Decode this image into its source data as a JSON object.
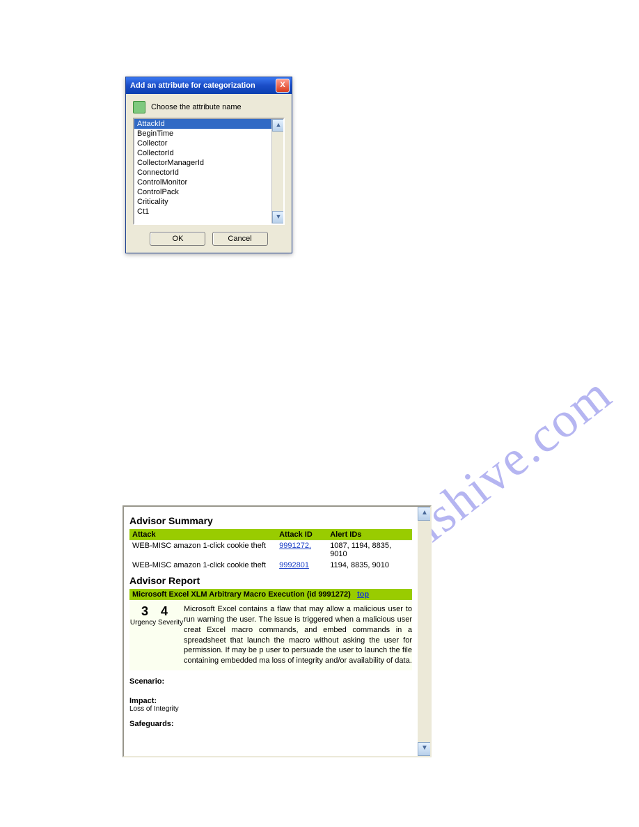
{
  "dialog": {
    "title": "Add an attribute for categorization",
    "choose_label": "Choose the attribute name",
    "items": [
      "AttackId",
      "BeginTime",
      "Collector",
      "CollectorId",
      "CollectorManagerId",
      "ConnectorId",
      "ControlMonitor",
      "ControlPack",
      "Criticality",
      "Ct1"
    ],
    "ok": "OK",
    "cancel": "Cancel"
  },
  "watermark": "manualshive.com",
  "report": {
    "summary_title": "Advisor Summary",
    "col_attack": "Attack",
    "col_attack_id": "Attack ID",
    "col_alert_ids": "Alert IDs",
    "rows": [
      {
        "attack": "WEB-MISC amazon 1-click cookie theft",
        "attack_id": "9991272,",
        "alerts": "1087, 1194, 8835, 9010"
      },
      {
        "attack": "WEB-MISC amazon 1-click cookie theft",
        "attack_id": "9992801",
        "alerts": "1194, 8835, 9010"
      }
    ],
    "report_title": "Advisor Report",
    "bar_text": "Microsoft Excel XLM Arbitrary Macro Execution (id 9991272)",
    "top_link": "top",
    "urgency_value": "3",
    "severity_value": "4",
    "urgency_label": "Urgency",
    "severity_label": "Severity",
    "description": "Microsoft Excel contains a flaw that may allow a malicious user to run warning the user. The issue is triggered when a malicious user creat Excel macro commands, and embed commands in a spreadsheet that launch the macro without asking the user for permission. If may be p user to persuade the user to launch the file containing embedded ma loss of integrity and/or availability of data.",
    "scenario_h": "Scenario:",
    "impact_h": "Impact:",
    "impact_t": "Loss of Integrity",
    "safeguards_h": "Safeguards:"
  }
}
